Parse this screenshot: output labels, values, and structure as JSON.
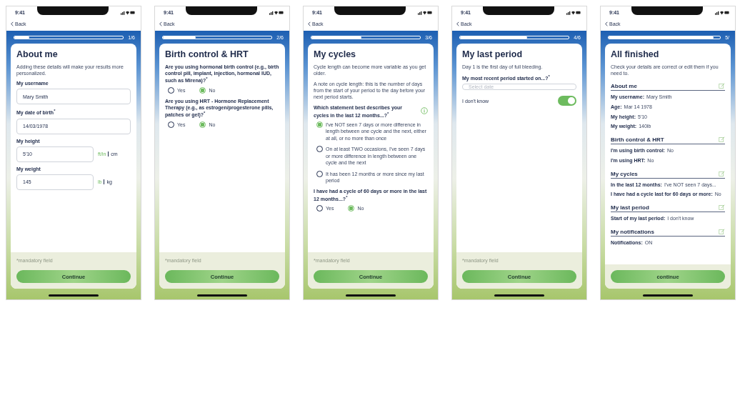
{
  "screens": [
    {
      "time": "9:41",
      "back": "Back",
      "progress": {
        "level": 0.14,
        "label": "1/6"
      },
      "title": "About me",
      "blocks": [
        {
          "kind": "paragraph",
          "text": "Adding these details will make your results more personalized."
        },
        {
          "kind": "input",
          "label": "My username",
          "value": "Mary Smith"
        },
        {
          "kind": "input",
          "label": "My date of birth$^{*}$",
          "value": "14/03/1978"
        },
        {
          "kind": "input",
          "label": "My height",
          "value": "5'10",
          "units": [
            {
              "label": "ft/in",
              "selected": true
            },
            {
              "label": "cm",
              "selected": false
            }
          ]
        },
        {
          "kind": "input",
          "label": "My weight",
          "value": "145",
          "units": [
            {
              "label": "lb",
              "selected": true
            },
            {
              "label": "kg",
              "selected": false
            }
          ]
        }
      ],
      "mandatory_note": "*mandatory field",
      "button": "Continue"
    },
    {
      "time": "9:41",
      "back": "Back",
      "progress": {
        "level": 0.3,
        "label": "2/6"
      },
      "title": "Birth control & HRT",
      "blocks": [
        {
          "kind": "question-row",
          "text": "Are you using hormonal birth control (e.g., birth control pill, implant, injection, hormonal IUD, such as Mirena)?$^{*}$",
          "options": [
            {
              "label": "Yes",
              "selected": false
            },
            {
              "label": "No",
              "selected": true
            }
          ]
        },
        {
          "kind": "question-row",
          "text": "Are you using HRT - Hormone Replacement Therapy (e.g., as estrogen/progesterone pills, patches or gel)?$^{*}$",
          "options": [
            {
              "label": "Yes",
              "selected": false
            },
            {
              "label": "No",
              "selected": true
            }
          ]
        }
      ],
      "mandatory_note": "*mandatory field",
      "button": "Continue"
    },
    {
      "time": "9:41",
      "back": "Back",
      "progress": {
        "level": 0.46,
        "label": "3/6"
      },
      "title": "My cycles",
      "blocks": [
        {
          "kind": "paragraph",
          "text": "Cycle length can become more variable as you get older."
        },
        {
          "kind": "paragraph",
          "text": "A note on cycle length: this is the number of days from the start of your period to the day before your next period starts."
        },
        {
          "kind": "question-list",
          "text": "Which statement best describes your cycles in the last 12 months...?$^{*}$",
          "info": true,
          "options": [
            {
              "label": "I've NOT seen 7 days or more difference in length between one cycle and the next, either at all, or no more than once",
              "selected": true
            },
            {
              "label": "On at least TWO occasions, I've seen 7 days or more difference in length between one cycle and the next",
              "selected": false
            },
            {
              "label": "It has been 12 months or more since my last period",
              "selected": false
            }
          ]
        },
        {
          "kind": "question-row",
          "text": "I have had a cycle of 60 days or more in the last 12 months...?$^{*}$",
          "options": [
            {
              "label": "Yes",
              "selected": false
            },
            {
              "label": "No",
              "selected": true
            }
          ]
        }
      ],
      "mandatory_note": "*mandatory field",
      "button": "Continue"
    },
    {
      "time": "9:41",
      "back": "Back",
      "progress": {
        "level": 0.62,
        "label": "4/6"
      },
      "title": "My last period",
      "blocks": [
        {
          "kind": "paragraph",
          "text": "Day 1 is the first day of full bleeding."
        },
        {
          "kind": "date",
          "label": "My most recent period started on...?$^{*}$",
          "placeholder": "Select date"
        },
        {
          "kind": "toggle",
          "label": "I don't know",
          "on": true
        }
      ],
      "mandatory_note": "*mandatory field",
      "button": "Continue"
    },
    {
      "time": "9:41",
      "back": "Back",
      "progress": {
        "level": 0.94,
        "label": "5/"
      },
      "title": "All finished",
      "blocks": [
        {
          "kind": "paragraph",
          "text": "Check your details are correct or edit them if you need to."
        },
        {
          "kind": "section",
          "title": "About me",
          "rows": [
            {
              "label": "My username:",
              "value": "Mary Smith"
            },
            {
              "label": "Age:",
              "value": "Mar 14 1978"
            },
            {
              "label": "My height:",
              "value": "5'10"
            },
            {
              "label": "My weight:",
              "value": "140lb"
            }
          ]
        },
        {
          "kind": "section",
          "title": "Birth control & HRT",
          "rows": [
            {
              "label": "I'm using birth control:",
              "value": "No"
            },
            {
              "label": "I'm using HRT:",
              "value": "No"
            }
          ]
        },
        {
          "kind": "section",
          "title": "My cycles",
          "rows": [
            {
              "label": "In the last 12 months:",
              "value": "I've NOT seen 7 days..."
            },
            {
              "label": "I have had a cycle last for 60 days or more:",
              "value": "No"
            }
          ]
        },
        {
          "kind": "section",
          "title": "My last period",
          "rows": [
            {
              "label": "Start of my last period:",
              "value": "I don't know"
            }
          ]
        },
        {
          "kind": "section",
          "title": "My notifications",
          "rows": [
            {
              "label": "Notifications:",
              "value": "ON"
            }
          ]
        }
      ],
      "button": "continue"
    }
  ]
}
